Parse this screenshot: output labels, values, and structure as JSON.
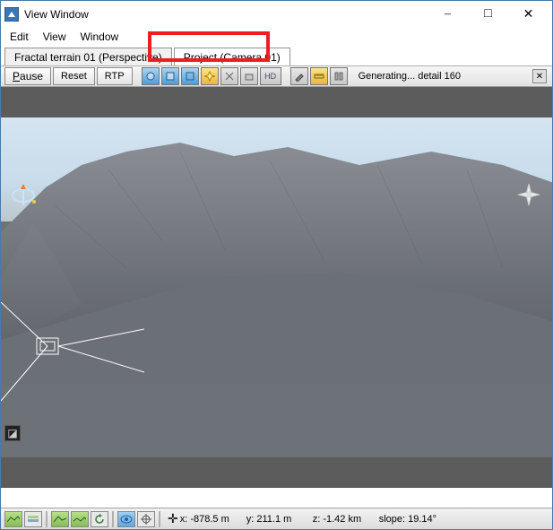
{
  "window": {
    "title": "View Window"
  },
  "menu": {
    "edit": "Edit",
    "view": "View",
    "window": "Window"
  },
  "tabs": {
    "t0": "Fractal terrain 01 (Perspective)",
    "t1": "Project (Camera 01)"
  },
  "toolbar": {
    "pause": "Pause",
    "reset": "Reset",
    "rtp": "RTP",
    "hd": "HD",
    "status": "Generating... detail 160"
  },
  "status": {
    "cursor_glyph": "✛",
    "x": "x: -878.5 m",
    "y": "y: 211.1 m",
    "z": "z: -1.42 km",
    "slope": "slope: 19.14°"
  }
}
